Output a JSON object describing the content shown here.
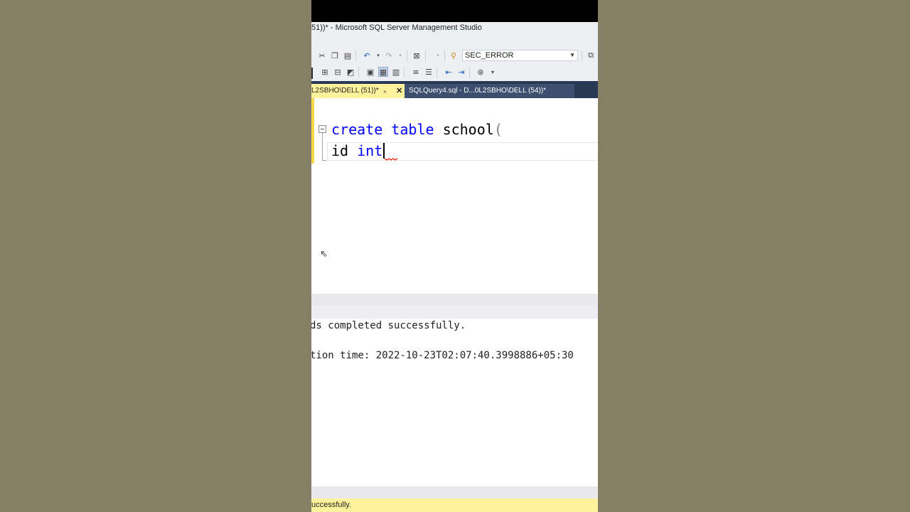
{
  "window": {
    "title": "51))* - Microsoft SQL Server Management Studio"
  },
  "toolbar": {
    "row1_icons": [
      "cut-icon",
      "copy-icon",
      "paste-icon",
      "undo-icon",
      "dropdown-arrow-icon",
      "redo-icon",
      "dropdown-arrow-icon",
      "save-results-icon",
      "dropdown-arrow-icon",
      "find-icon",
      "query-icon"
    ],
    "row2_icons": [
      "include-plan-icon",
      "statistics-icon",
      "client-stats-icon",
      "results-text-icon",
      "results-grid-icon",
      "results-file-icon",
      "comment-icon",
      "uncomment-icon",
      "decrease-indent-icon",
      "increase-indent-icon",
      "specify-values-icon",
      "overflow-icon"
    ],
    "database": "SEC_ERROR"
  },
  "tabs": {
    "active": {
      "label": "L2SBHO\\DELL (51))*",
      "pin": "ₕ",
      "close": "✕"
    },
    "inactive": {
      "label": "SQLQuery4.sql - D...0L2SBHO\\DELL (54))*"
    }
  },
  "editor": {
    "line1": {
      "kw1": "create",
      "kw2": "table",
      "ident": "school",
      "paren": "("
    },
    "line2": {
      "ident": "id",
      "kw": "int"
    }
  },
  "results": {
    "message": "ds completed successfully.",
    "completion": "tion time: 2022-10-23T02:07:40.3998886+05:30"
  },
  "status": {
    "text": "uccessfully."
  },
  "colors": {
    "status_bar": "#fff29d",
    "tab_strip": "#293955",
    "keyword": "#0000ff"
  }
}
